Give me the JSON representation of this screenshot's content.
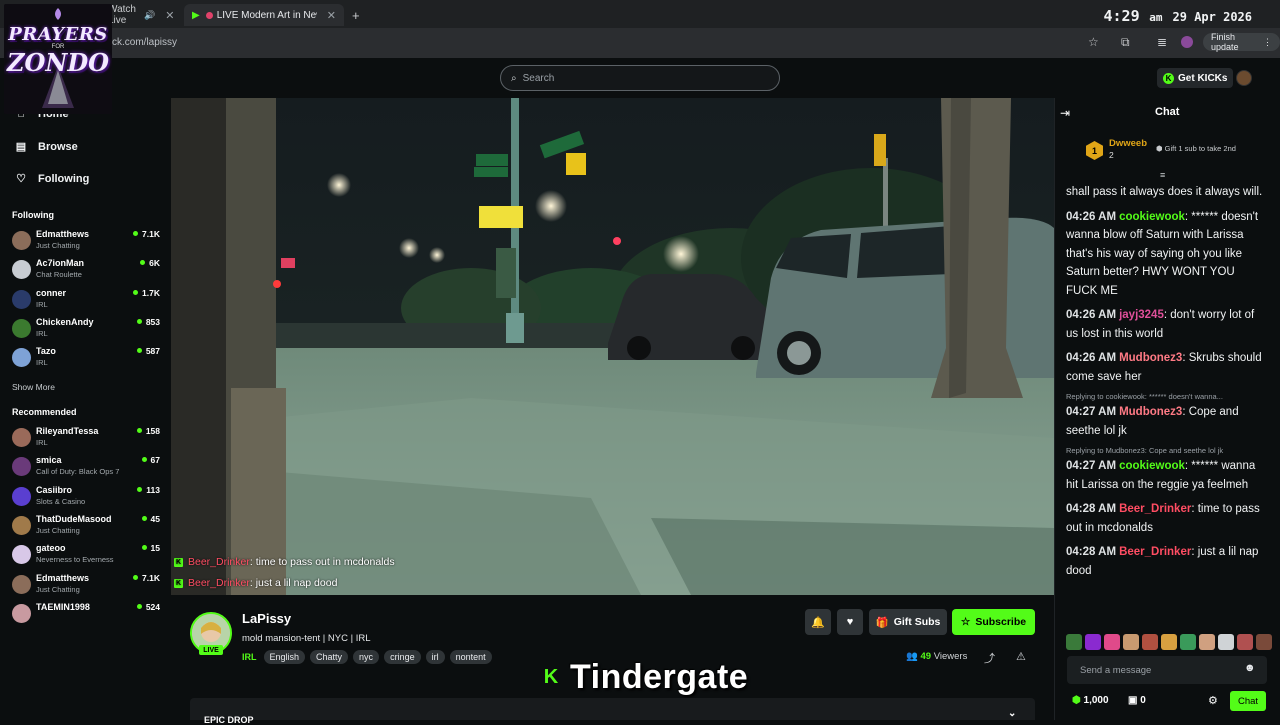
{
  "browser": {
    "tabs": [
      {
        "label": "Watch Live"
      },
      {
        "label": "LIVE Modern Art in New Yo"
      }
    ],
    "new_tab": "+",
    "url": "ck.com/lapissy",
    "finish_update": "Finish update",
    "clock": {
      "time": "4:29",
      "ampm": "am",
      "date": "29 Apr 2026"
    }
  },
  "overlay_logo": {
    "line1": "PRAYERS",
    "line_for": "FOR",
    "line2": "ZONDO"
  },
  "topbar": {
    "search_placeholder": "Search",
    "get_kicks": "Get KICKs"
  },
  "sidebar": {
    "nav": [
      {
        "label": "Home",
        "icon": "home-icon"
      },
      {
        "label": "Browse",
        "icon": "browse-icon"
      },
      {
        "label": "Following",
        "icon": "heart-icon"
      }
    ],
    "following_title": "Following",
    "following": [
      {
        "name": "Edmatthews",
        "category": "Just Chatting",
        "viewers": "7.1K",
        "color": "#8b6d5a"
      },
      {
        "name": "Ac7ionMan",
        "category": "Chat Roulette",
        "viewers": "6K",
        "color": "#c8ccd2"
      },
      {
        "name": "conner",
        "category": "IRL",
        "viewers": "1.7K",
        "color": "#2a3b6a"
      },
      {
        "name": "ChickenAndy",
        "category": "IRL",
        "viewers": "853",
        "color": "#3b7a2f"
      },
      {
        "name": "Tazo",
        "category": "IRL",
        "viewers": "587",
        "color": "#7ea2d6"
      }
    ],
    "show_more": "Show More",
    "recommended_title": "Recommended",
    "recommended": [
      {
        "name": "RileyandTessa",
        "category": "IRL",
        "viewers": "158",
        "color": "#9a6a5a"
      },
      {
        "name": "smica",
        "category": "Call of Duty: Black Ops 7",
        "viewers": "67",
        "color": "#6a3a7a"
      },
      {
        "name": "Casiibro",
        "category": "Slots & Casino",
        "viewers": "113",
        "color": "#5a3fd0"
      },
      {
        "name": "ThatDudeMasood",
        "category": "Just Chatting",
        "viewers": "45",
        "color": "#a07a4a"
      },
      {
        "name": "gateoo",
        "category": "Neverness to Everness",
        "viewers": "15",
        "color": "#d8c8e8"
      },
      {
        "name": "Edmatthews",
        "category": "Just Chatting",
        "viewers": "7.1K",
        "color": "#8b6d5a"
      },
      {
        "name": "TAEMIN1998",
        "category": "",
        "viewers": "524",
        "color": "#c89aa0"
      }
    ]
  },
  "video_overlay": [
    {
      "user": "Beer_Drinker",
      "text": ": time to pass out in mcdonalds"
    },
    {
      "user": "Beer_Drinker",
      "text": ": just a lil nap dood"
    }
  ],
  "stream": {
    "streamer": "LaPissy",
    "live": "LIVE",
    "title": "mold mansion-tent | NYC | IRL",
    "category": "IRL",
    "tags": [
      "English",
      "Chatty",
      "nyc",
      "cringe",
      "irl",
      "nontent"
    ],
    "gift_subs": "Gift Subs",
    "subscribe": "Subscribe",
    "viewers": "49",
    "viewers_label": "Viewers",
    "section": "EPIC DROP"
  },
  "caption": {
    "text": "Tindergate",
    "logo": "K"
  },
  "chat": {
    "title": "Chat",
    "pinned": {
      "rank": "1",
      "user": "Dwweeb",
      "count": "2",
      "gift_text": "Gift 1 sub to take 2nd"
    },
    "messages": [
      {
        "time": "",
        "user": "",
        "user_color": "#ffffff",
        "text": "shall pass it always does it always will.",
        "reply": ""
      },
      {
        "time": "04:26 AM",
        "user": "cookiewook",
        "user_color": "#53fc18",
        "text": ": ****** doesn't wanna blow off Saturn with Larissa that's his way of saying oh you like Saturn better? HWY WONT YOU FUCK ME",
        "reply": ""
      },
      {
        "time": "04:26 AM",
        "user": "jayj3245",
        "user_color": "#e0509a",
        "text": ": don't worry lot of us lost in this world",
        "reply": ""
      },
      {
        "time": "04:26 AM",
        "user": "Mudbonez3",
        "user_color": "#ff7a85",
        "text": ": Skrubs should come save her",
        "reply": ""
      },
      {
        "time": "04:27 AM",
        "user": "Mudbonez3",
        "user_color": "#ff7a85",
        "text": ": Cope and seethe lol jk",
        "reply": "Replying to cookiewook: ****** doesn't wanna..."
      },
      {
        "time": "04:27 AM",
        "user": "cookiewook",
        "user_color": "#53fc18",
        "text": ": ****** wanna hit Larissa on the reggie ya feelmeh",
        "reply": "Replying to Mudbonez3: Cope and seethe lol jk"
      },
      {
        "time": "04:28 AM",
        "user": "Beer_Drinker",
        "user_color": "#ff4d63",
        "text": ": time to pass out in mcdonalds",
        "reply": ""
      },
      {
        "time": "04:28 AM",
        "user": "Beer_Drinker",
        "user_color": "#ff4d63",
        "text": ": just a lil nap dood",
        "reply": ""
      }
    ],
    "input_placeholder": "Send a message",
    "points": "1,000",
    "kicks": "0",
    "send": "Chat"
  }
}
